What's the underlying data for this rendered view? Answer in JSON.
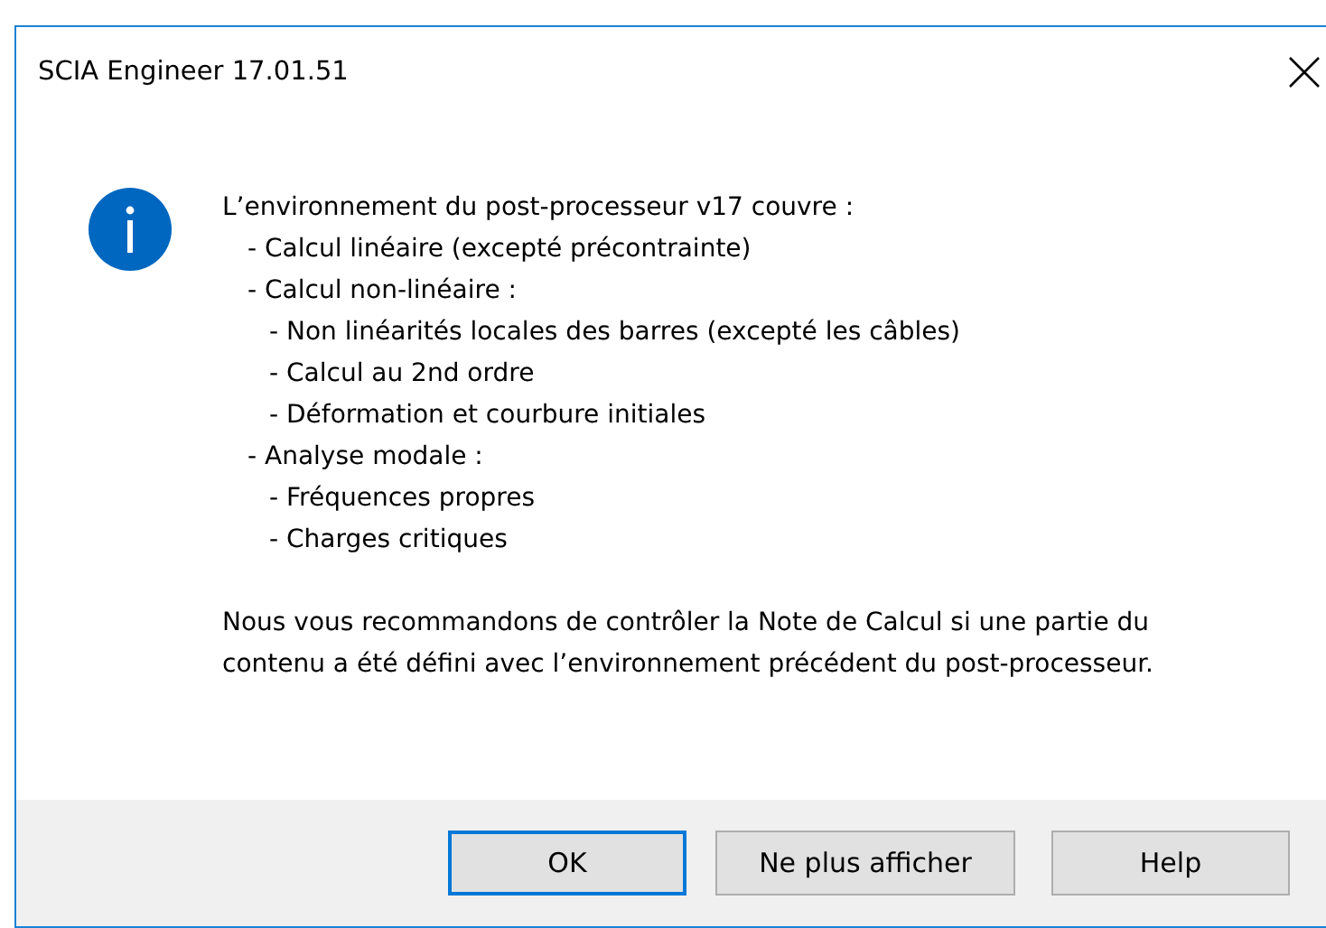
{
  "window": {
    "title": "SCIA Engineer 17.01.51"
  },
  "message": {
    "intro": "L’environnement du post-processeur v17 couvre :",
    "items": [
      {
        "text": "- Calcul linéaire (excepté précontrainte)"
      },
      {
        "text": "- Calcul non-linéaire :",
        "children": [
          {
            "text": "- Non linéarités locales des barres (excepté les câbles)"
          },
          {
            "text": "- Calcul au 2nd ordre"
          },
          {
            "text": "- Déformation et courbure initiales"
          }
        ]
      },
      {
        "text": "- Analyse modale :",
        "children": [
          {
            "text": "- Fréquences propres"
          },
          {
            "text": "- Charges critiques"
          }
        ]
      }
    ],
    "note": "Nous vous recommandons de contrôler la Note de Calcul si une partie du contenu a été défini avec l’environnement précédent du post-processeur."
  },
  "buttons": [
    {
      "label": "OK",
      "default": true
    },
    {
      "label": "Ne plus afficher",
      "default": false
    },
    {
      "label": "Help",
      "default": false
    }
  ]
}
